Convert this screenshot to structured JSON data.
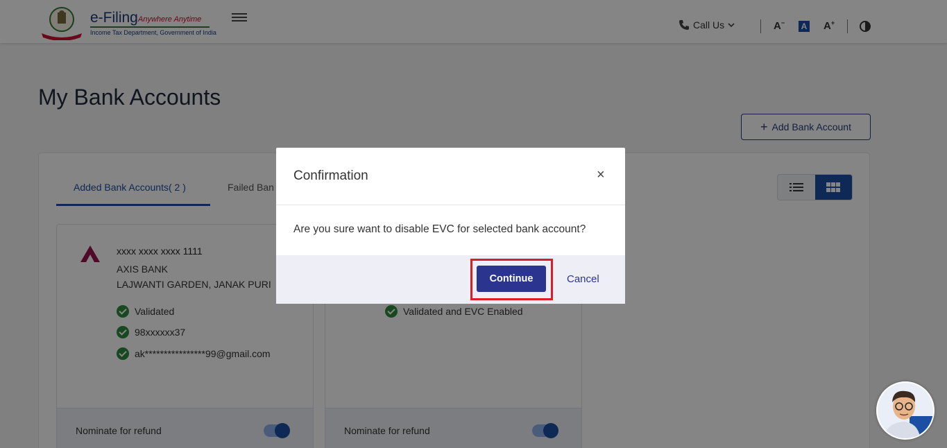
{
  "header": {
    "logo_title": "e-Filing",
    "logo_tagline": "Anywhere Anytime",
    "logo_subtitle": "Income Tax Department, Government of India",
    "call_us": "Call Us",
    "font_decrease": "A",
    "font_normal": "A",
    "font_increase": "A"
  },
  "page": {
    "title": "My Bank Accounts",
    "add_button": "Add Bank Account",
    "tabs": [
      {
        "label": "Added Bank Accounts( 2 )",
        "active": true
      },
      {
        "label": "Failed Ban",
        "active": false
      }
    ]
  },
  "cards": [
    {
      "account_number": "xxxx xxxx xxxx 1111",
      "bank_name": "AXIS BANK",
      "branch": "LAJWANTI GARDEN, JANAK PURI",
      "checks": [
        "Validated",
        "98xxxxxx37",
        "ak****************99@gmail.com"
      ],
      "nominate_label": "Nominate for refund"
    },
    {
      "checks": [
        "Validated and EVC Enabled"
      ],
      "nominate_label": "Nominate for refund"
    }
  ],
  "modal": {
    "title": "Confirmation",
    "close": "×",
    "message": "Are you sure want to disable EVC for selected bank account?",
    "continue_label": "Continue",
    "cancel_label": "Cancel"
  },
  "colors": {
    "primary": "#2b3590",
    "accent_blue": "#1b4fa3",
    "highlight": "#d81f26",
    "success": "#2e8b3d"
  }
}
